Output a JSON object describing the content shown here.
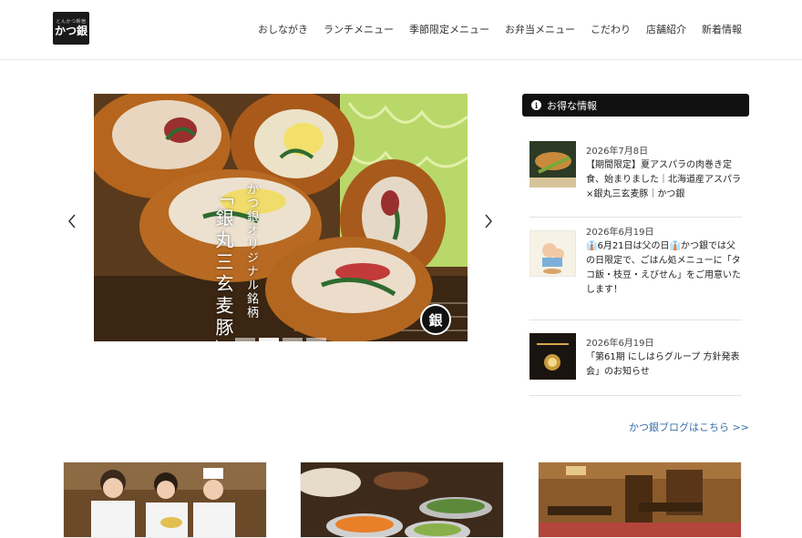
{
  "logo": {
    "sub": "とんかつ新宿",
    "main": "かつ銀"
  },
  "nav": [
    "おしながき",
    "ランチメニュー",
    "季節限定メニュー",
    "お弁当メニュー",
    "こだわり",
    "店舗紹介",
    "新着情報"
  ],
  "slider": {
    "caption_small": "かつ銀オリジナル銘柄",
    "caption_big": "「銀丸三玄麦豚」",
    "badge": "銀",
    "dots": 4,
    "active_dot": 1
  },
  "sidebar": {
    "heading": "お得な情報",
    "news": [
      {
        "date": "2026年7月8日",
        "title": "【期間限定】夏アスパラの肉巻き定食、始まりました｜北海道産アスパラ×銀丸三玄麦豚｜かつ銀",
        "thumb": "asparagus-cutlet-thumb"
      },
      {
        "date": "2026年6月19日",
        "title": "👔6月21日は父の日👔かつ銀では父の日限定で、ごはん処メニューに「タコ飯・枝豆・えびせん」をご用意いたします！",
        "thumb": "fathers-day-thumb"
      },
      {
        "date": "2026年6月19日",
        "title": "「第61期 にしはらグループ 方針発表会」のお知らせ",
        "thumb": "policy-meeting-thumb"
      }
    ],
    "blog_link": "かつ銀ブログはこちら >>"
  },
  "photos": [
    "staff-photo",
    "salad-bar-photo",
    "dining-room-photo"
  ],
  "colors": {
    "heading_bg": "#111111",
    "link": "#3a6fa8",
    "cutlet": "#b5651d",
    "cabbage": "#b9d86a"
  }
}
